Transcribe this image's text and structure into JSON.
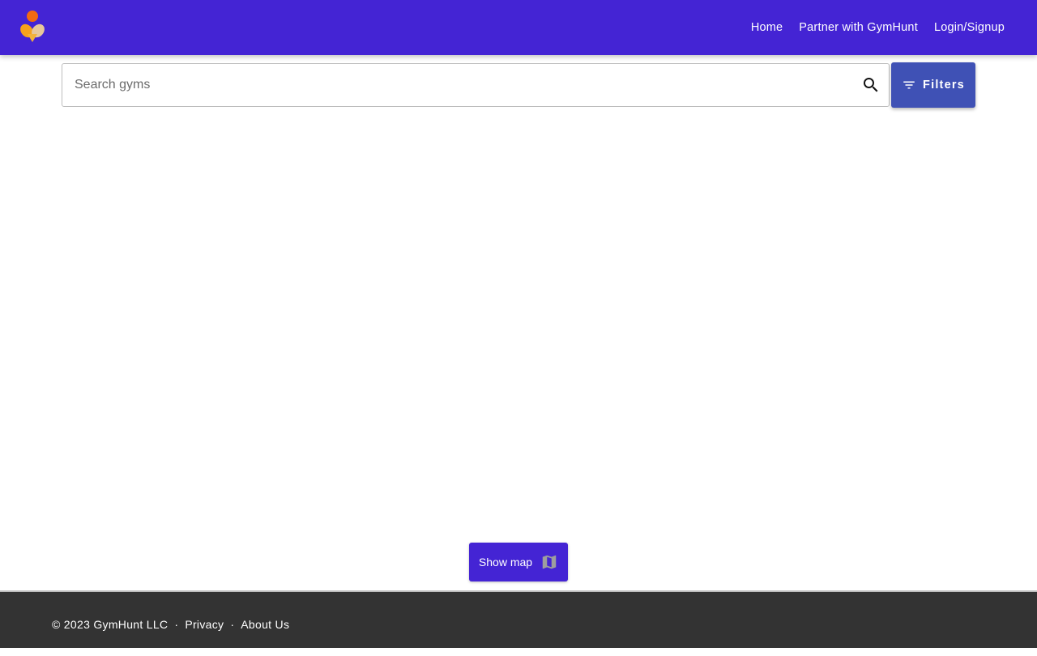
{
  "header": {
    "logo_icon": "gymhunt-logo",
    "nav": [
      {
        "label": "Home"
      },
      {
        "label": "Partner with GymHunt"
      },
      {
        "label": "Login/Signup"
      }
    ],
    "bg_color": "#4424d4"
  },
  "search": {
    "placeholder": "Search gyms",
    "value": "",
    "icon": "search-icon"
  },
  "filters": {
    "label": "Filters",
    "icon": "filter-icon",
    "color": "#3f51b5"
  },
  "show_map": {
    "label": "Show map",
    "icon": "map-icon"
  },
  "footer": {
    "copyright": "© 2023 GymHunt LLC",
    "sep1": "·",
    "privacy": "Privacy",
    "sep2": "·",
    "about": "About Us",
    "bg_color": "#333333"
  }
}
